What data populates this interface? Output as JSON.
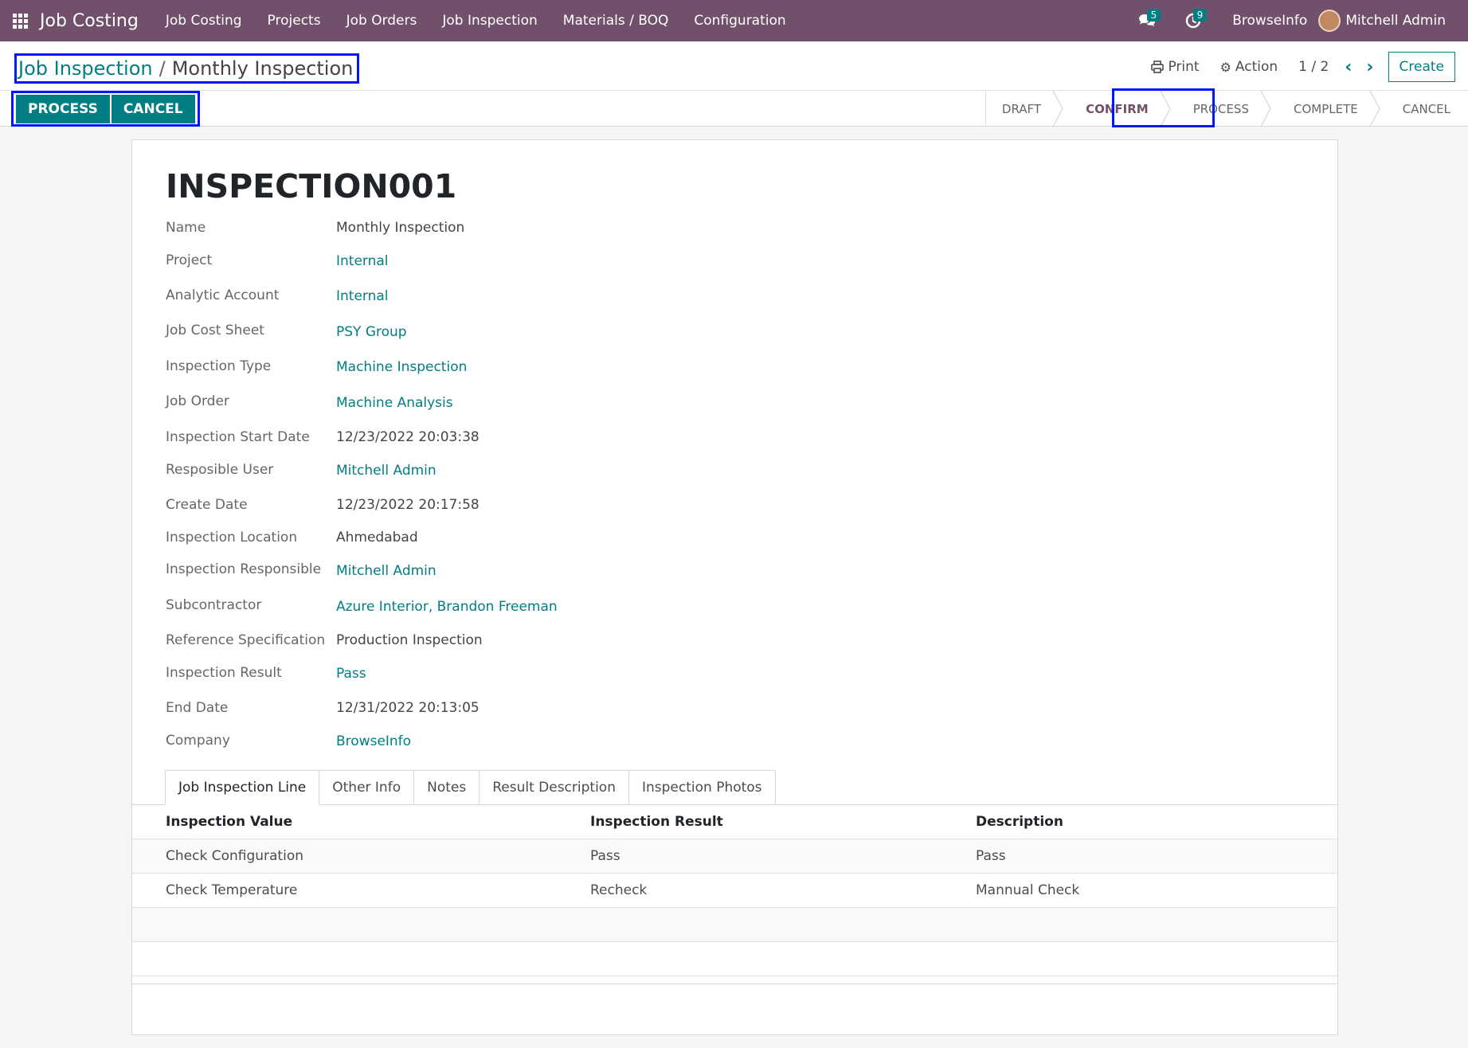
{
  "navbar": {
    "brand": "Job Costing",
    "menu": [
      "Job Costing",
      "Projects",
      "Job Orders",
      "Job Inspection",
      "Materials / BOQ",
      "Configuration"
    ],
    "messages_count": "5",
    "activities_count": "9",
    "company": "BrowseInfo",
    "user": "Mitchell Admin"
  },
  "breadcrumb": {
    "parent": "Job Inspection",
    "separator": "/",
    "current": "Monthly Inspection"
  },
  "control": {
    "print_label": "Print",
    "action_label": "Action",
    "pager": "1 / 2",
    "create_label": "Create"
  },
  "actions": {
    "process_label": "PROCESS",
    "cancel_label": "CANCEL"
  },
  "statusbar": {
    "stages": [
      "DRAFT",
      "CONFIRM",
      "PROCESS",
      "COMPLETE",
      "CANCEL"
    ],
    "current": "CONFIRM"
  },
  "record": {
    "title": "INSPECTION001",
    "fields": [
      {
        "label": "Name",
        "value": "Monthly Inspection",
        "link": false
      },
      {
        "label": "Project",
        "value": "Internal",
        "link": true
      },
      {
        "label": "Analytic Account",
        "value": "Internal",
        "link": true
      },
      {
        "label": "Job Cost Sheet",
        "value": "PSY Group",
        "link": true
      },
      {
        "label": "Inspection Type",
        "value": "Machine Inspection",
        "link": true
      },
      {
        "label": "Job Order",
        "value": "Machine Analysis",
        "link": true
      },
      {
        "label": "Inspection Start Date",
        "value": "12/23/2022 20:03:38",
        "link": false
      },
      {
        "label": "Resposible User",
        "value": "Mitchell Admin",
        "link": true
      },
      {
        "label": "Create Date",
        "value": "12/23/2022 20:17:58",
        "link": false
      },
      {
        "label": "Inspection Location",
        "value": "Ahmedabad",
        "link": false
      },
      {
        "label": "Inspection Responsible",
        "value": "Mitchell Admin",
        "link": true
      },
      {
        "label": "Subcontractor",
        "value": "Azure Interior, Brandon Freeman",
        "link": true
      },
      {
        "label": "Reference Specification",
        "value": "Production Inspection",
        "link": false
      },
      {
        "label": "Inspection Result",
        "value": "Pass",
        "link": true
      },
      {
        "label": "End Date",
        "value": "12/31/2022 20:13:05",
        "link": false
      },
      {
        "label": "Company",
        "value": "BrowseInfo",
        "link": true
      }
    ]
  },
  "tabs": [
    "Job Inspection Line",
    "Other Info",
    "Notes",
    "Result Description",
    "Inspection Photos"
  ],
  "table": {
    "columns": [
      "Inspection Value",
      "Inspection Result",
      "Description"
    ],
    "rows": [
      [
        "Check Configuration",
        "Pass",
        "Pass"
      ],
      [
        "Check Temperature",
        "Recheck",
        "Mannual Check"
      ]
    ]
  },
  "colors": {
    "navbar": "#71506b",
    "primary": "#017e84",
    "highlight": "#0016ff"
  },
  "icons": [
    "apps-grid-icon",
    "chat-icon",
    "clock-icon",
    "print-icon",
    "gear-icon",
    "chevron-left-icon",
    "chevron-right-icon"
  ]
}
